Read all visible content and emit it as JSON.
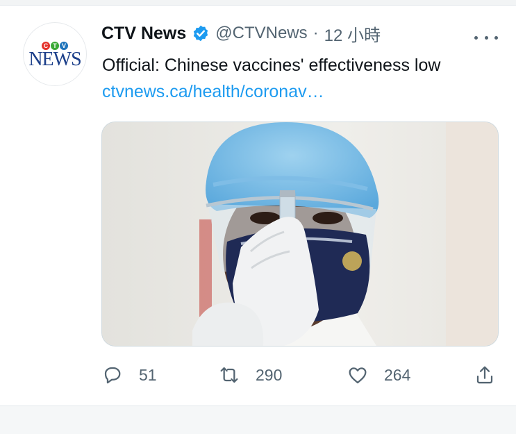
{
  "tweet": {
    "avatar": {
      "logo_mark": [
        "C",
        "T",
        "V"
      ],
      "logo_word": "NEWS"
    },
    "author": {
      "name": "CTV News",
      "handle": "@CTVNews"
    },
    "separator": "·",
    "timestamp": "12 小時",
    "text": "Official: Chinese vaccines' effectiveness low",
    "link": "ctvnews.ca/health/coronav…",
    "media": {
      "icon": "photo-health-worker-vaccine-vial"
    },
    "actions": {
      "reply_count": "51",
      "retweet_count": "290",
      "like_count": "264"
    }
  },
  "colors": {
    "text_primary": "#0f1419",
    "text_secondary": "#536471",
    "link": "#1d9bf0",
    "verified": "#1d9bf0",
    "ctv_red": "#e4322b",
    "ctv_green": "#39a935",
    "ctv_blue": "#1f74bb",
    "ctv_news_blue": "#1c3f8a"
  }
}
